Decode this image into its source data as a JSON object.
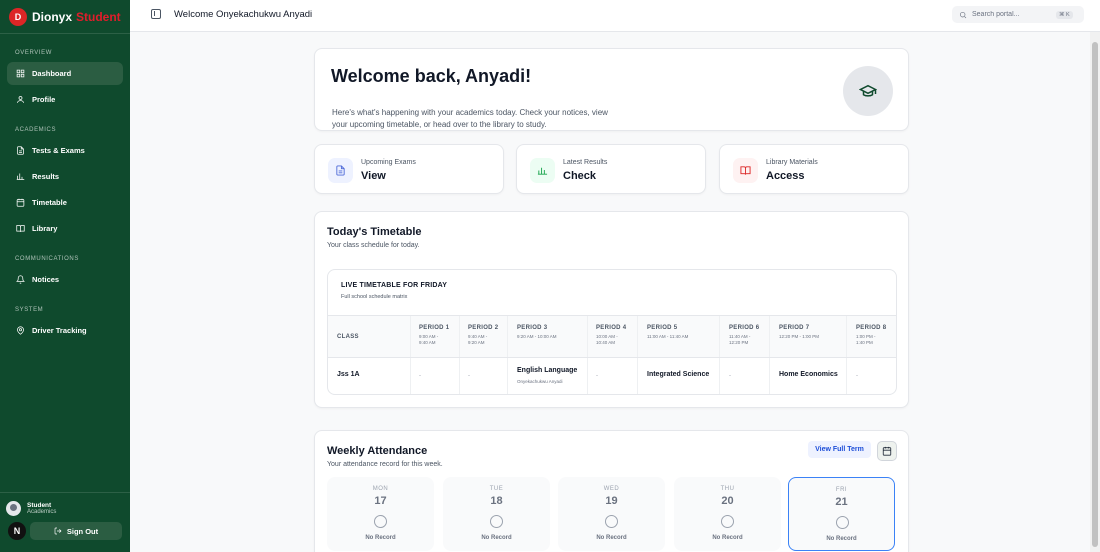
{
  "brand": {
    "logo_letter": "D",
    "name": "Dionyx",
    "tag": "Student"
  },
  "sidebar": {
    "sections": [
      {
        "label": "Overview",
        "items": [
          {
            "label": "Dashboard",
            "icon": "grid-icon"
          },
          {
            "label": "Profile",
            "icon": "user-icon"
          }
        ]
      },
      {
        "label": "Academics",
        "items": [
          {
            "label": "Tests & Exams",
            "icon": "file-icon"
          },
          {
            "label": "Results",
            "icon": "chart-icon"
          },
          {
            "label": "Timetable",
            "icon": "calendar-icon"
          },
          {
            "label": "Library",
            "icon": "book-icon"
          }
        ]
      },
      {
        "label": "Communications",
        "items": [
          {
            "label": "Notices",
            "icon": "bell-icon"
          }
        ]
      },
      {
        "label": "System",
        "items": [
          {
            "label": "Driver Tracking",
            "icon": "map-pin-icon"
          }
        ]
      }
    ],
    "user": {
      "name": "Student",
      "role": "Academics"
    },
    "n_badge": "N",
    "signout_label": "Sign Out"
  },
  "topbar": {
    "title": "Welcome Onyekachukwu Anyadi",
    "search_placeholder": "Search portal...",
    "shortcut": "⌘ K"
  },
  "welcome": {
    "heading": "Welcome back, Anyadi!",
    "line1": "Here's what's happening with your academics today. Check your notices, view",
    "line2": "your upcoming timetable, or head over to the library to study."
  },
  "stats": [
    {
      "label": "Upcoming Exams",
      "value": "View",
      "color": "#4f6bd8",
      "bg": "#eef2ff"
    },
    {
      "label": "Latest Results",
      "value": "Check",
      "color": "#16a34a",
      "bg": "#ecfdf3"
    },
    {
      "label": "Library Materials",
      "value": "Access",
      "color": "#dc2626",
      "bg": "#fef2f2"
    }
  ],
  "timetable": {
    "title": "Today's Timetable",
    "subtitle": "Your class schedule for today.",
    "inner_title": "LIVE TIMETABLE FOR FRIDAY",
    "inner_subtitle": "Full school schedule matrix",
    "class_header": "CLASS",
    "periods": [
      {
        "label": "PERIOD 1",
        "time1": "9:00 AM -",
        "time2": "9:40 AM"
      },
      {
        "label": "PERIOD 2",
        "time1": "9:40 AM -",
        "time2": "9:20 AM"
      },
      {
        "label": "PERIOD 3",
        "time1": "9:20 AM - 10:00 AM",
        "time2": ""
      },
      {
        "label": "PERIOD 4",
        "time1": "10:00 AM -",
        "time2": "10:40 AM"
      },
      {
        "label": "PERIOD 5",
        "time1": "11:00 AM - 11:40 AM",
        "time2": ""
      },
      {
        "label": "PERIOD 6",
        "time1": "11:40 AM -",
        "time2": "12:20 PM"
      },
      {
        "label": "PERIOD 7",
        "time1": "12:20 PM - 1:00 PM",
        "time2": ""
      },
      {
        "label": "PERIOD 8",
        "time1": "1:00 PM -",
        "time2": "1:40 PM"
      }
    ],
    "row": {
      "class": "Jss 1A",
      "cells": [
        "-",
        "-",
        "English Language",
        "-",
        "Integrated Science",
        "-",
        "Home Economics",
        "-"
      ],
      "p3_teacher": "Onyekachukwu Anyadi"
    }
  },
  "attendance": {
    "title": "Weekly Attendance",
    "subtitle": "Your attendance record for this week.",
    "view_label": "View Full Term",
    "days": [
      {
        "name": "MON",
        "num": "17",
        "status": "No Record"
      },
      {
        "name": "TUE",
        "num": "18",
        "status": "No Record"
      },
      {
        "name": "WED",
        "num": "19",
        "status": "No Record"
      },
      {
        "name": "THU",
        "num": "20",
        "status": "No Record"
      },
      {
        "name": "FRI",
        "num": "21",
        "status": "No Record"
      }
    ]
  }
}
